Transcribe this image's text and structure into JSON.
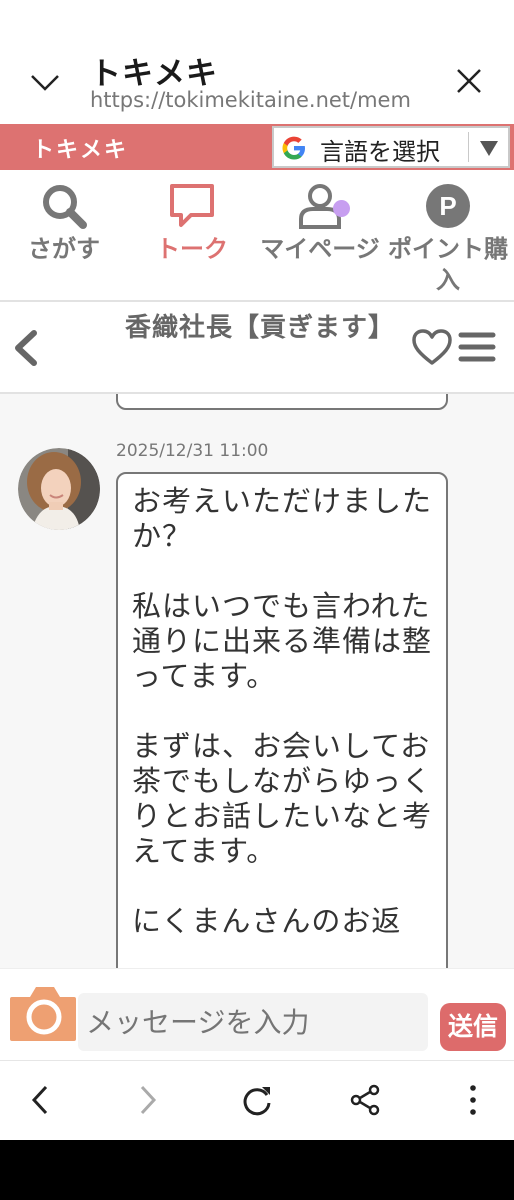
{
  "browser": {
    "title": "トキメキ",
    "url": "https://tokimekitaine.net/mem"
  },
  "banner": {
    "brand": "トキメキ",
    "language_button": "言語を選択"
  },
  "nav": {
    "items": [
      {
        "label": "さがす",
        "icon": "search-icon"
      },
      {
        "label": "トーク",
        "icon": "chat-bubble-icon",
        "active": true
      },
      {
        "label": "マイページ",
        "icon": "person-icon"
      },
      {
        "label": "ポイント購入",
        "icon": "point-p-icon"
      }
    ]
  },
  "chat": {
    "title": "香織社長【貢ぎます】",
    "message": {
      "timestamp": "2025/12/31 11:00",
      "text": "お考えいただけましたか？\n\n私はいつでも言われた通りに出来る準備は整ってます。\n\nまずは、お会いしてお茶でもしながらゆっくりとお話したいなと考えてます。\n\nにくまんさんのお返"
    }
  },
  "composer": {
    "placeholder": "メッセージを入力",
    "send_label": "送信"
  },
  "colors": {
    "brand": "#dd7271",
    "badge": "#c79ef0"
  }
}
